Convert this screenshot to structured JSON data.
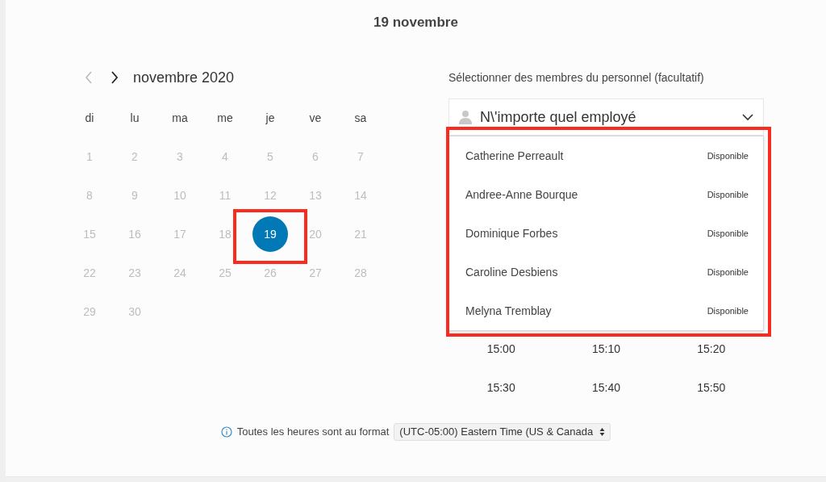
{
  "title": "19 novembre",
  "calendar": {
    "month": "novembre 2020",
    "prev_disabled": true,
    "weekdays": [
      "di",
      "lu",
      "ma",
      "me",
      "je",
      "ve",
      "sa"
    ],
    "days": [
      {
        "label": "1",
        "selected": false
      },
      {
        "label": "2",
        "selected": false
      },
      {
        "label": "3",
        "selected": false
      },
      {
        "label": "4",
        "selected": false
      },
      {
        "label": "5",
        "selected": false
      },
      {
        "label": "6",
        "selected": false
      },
      {
        "label": "7",
        "selected": false
      },
      {
        "label": "8",
        "selected": false
      },
      {
        "label": "9",
        "selected": false
      },
      {
        "label": "10",
        "selected": false
      },
      {
        "label": "11",
        "selected": false
      },
      {
        "label": "12",
        "selected": false
      },
      {
        "label": "13",
        "selected": false
      },
      {
        "label": "14",
        "selected": false
      },
      {
        "label": "15",
        "selected": false
      },
      {
        "label": "16",
        "selected": false
      },
      {
        "label": "17",
        "selected": false
      },
      {
        "label": "18",
        "selected": false
      },
      {
        "label": "19",
        "selected": true
      },
      {
        "label": "20",
        "selected": false
      },
      {
        "label": "21",
        "selected": false
      },
      {
        "label": "22",
        "selected": false
      },
      {
        "label": "23",
        "selected": false
      },
      {
        "label": "24",
        "selected": false
      },
      {
        "label": "25",
        "selected": false
      },
      {
        "label": "26",
        "selected": false
      },
      {
        "label": "27",
        "selected": false
      },
      {
        "label": "28",
        "selected": false
      },
      {
        "label": "29",
        "selected": false
      },
      {
        "label": "30",
        "selected": false
      }
    ]
  },
  "staff": {
    "label": "Sélectionner des membres du personnel (facultatif)",
    "value": "N\\'importe quel employé",
    "expanded": true,
    "options": [
      {
        "name": "Catherine Perreault",
        "status": "Disponible"
      },
      {
        "name": "Andree-Anne Bourque",
        "status": "Disponible"
      },
      {
        "name": "Dominique Forbes",
        "status": "Disponible"
      },
      {
        "name": "Caroline Desbiens",
        "status": "Disponible"
      },
      {
        "name": "Melyna Tremblay",
        "status": "Disponible"
      }
    ]
  },
  "time_slots": [
    "15:00",
    "15:10",
    "15:20",
    "15:30",
    "15:40",
    "15:50"
  ],
  "timezone": {
    "label": "Toutes les heures sont au format",
    "value": "(UTC-05:00) Eastern Time (US & Canada"
  }
}
